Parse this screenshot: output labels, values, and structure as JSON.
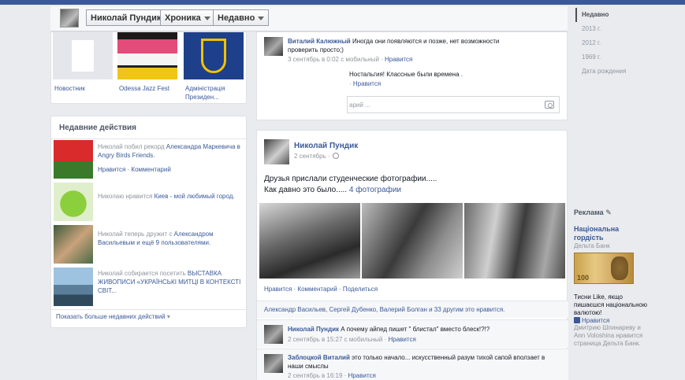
{
  "header": {
    "name_button": "Николай Пундик",
    "chronicle_button": "Хроника",
    "recent_button": "Недавно"
  },
  "scrubber": [
    "Недавно",
    "2013 г.",
    "2012 г.",
    "1969 г.",
    "Дата рождения"
  ],
  "likes": [
    "Новостник",
    "Odessa Jazz Fest",
    "Адміністрація Президен..."
  ],
  "recent": {
    "title": "Недавние действия",
    "items": [
      {
        "text_pre": "Николай побил рекорд ",
        "text_hl": "Александра Маркевича в Angry Birds Friends.",
        "sub": "Нравится · Комментарий"
      },
      {
        "text_pre": "Николаю нравится ",
        "text_hl": "Киев - мой любимый город.",
        "sub": ""
      },
      {
        "text_pre": "Николай теперь дружит с ",
        "text_hl": "Александром Васильевым и ещё 9 пользователями.",
        "sub": ""
      },
      {
        "text_pre": "Николай собирается посетить ",
        "text_hl": "ВЫСТАВКА ЖИВОПИСИ «УКРАЇНСЬКІ МИТЦІ В КОНТЕКСТІ СВІТ...",
        "sub": ""
      }
    ],
    "show_more": "Показать больше недавних действий"
  },
  "top_post": {
    "comment1_name": "Виталий Калюжный",
    "comment1_text": "Иногда они появляются и позже, нет возможности проверить просто;)",
    "comment1_meta": "3 сентябрь в 0:02 с мобильный",
    "comment1_like": "Нравится",
    "comment2_text": "Ностальгия! Классные были времена .",
    "comment2_like": "Нравится",
    "reply_placeholder": "арий ..."
  },
  "main_post": {
    "author": "Николай Пундик",
    "date": "2 сентябрь",
    "text_line1": "Друзья прислали студенческие фотографии.....",
    "text_line2": "Как давно это было.....",
    "photos_link": "4 фотографии",
    "actions": "Нравится · Комментарий · Поделиться",
    "likes_line": "Александр Васильев, Сергей Дубенко, Валерий Болган и 33 другим это нравится.",
    "comments": [
      {
        "name": "Николай Пундик",
        "text": "А почему айпед пишет \" блистал\" вместо блеск!?!?",
        "meta": "2 сентябрь в 15:27 с мобильный",
        "like": "Нравится"
      },
      {
        "name": "Заблоцкой Виталий",
        "text": "это только начало... искусственный разум тихой сапой вползает в наши смыслы",
        "meta": "2 сентябрь в 16:19",
        "like": "Нравится"
      }
    ]
  },
  "ads": {
    "title": "Реклама",
    "headline": "Національна гордість",
    "site": "Дельта Банк",
    "note_value": "100",
    "body": "Тисни Like, якщо пишаєшся національною валютою!",
    "like": "Нравится",
    "social": "Дмитрию Шпинареву и Ann Voloshina нравится страница Дельта Банк."
  }
}
